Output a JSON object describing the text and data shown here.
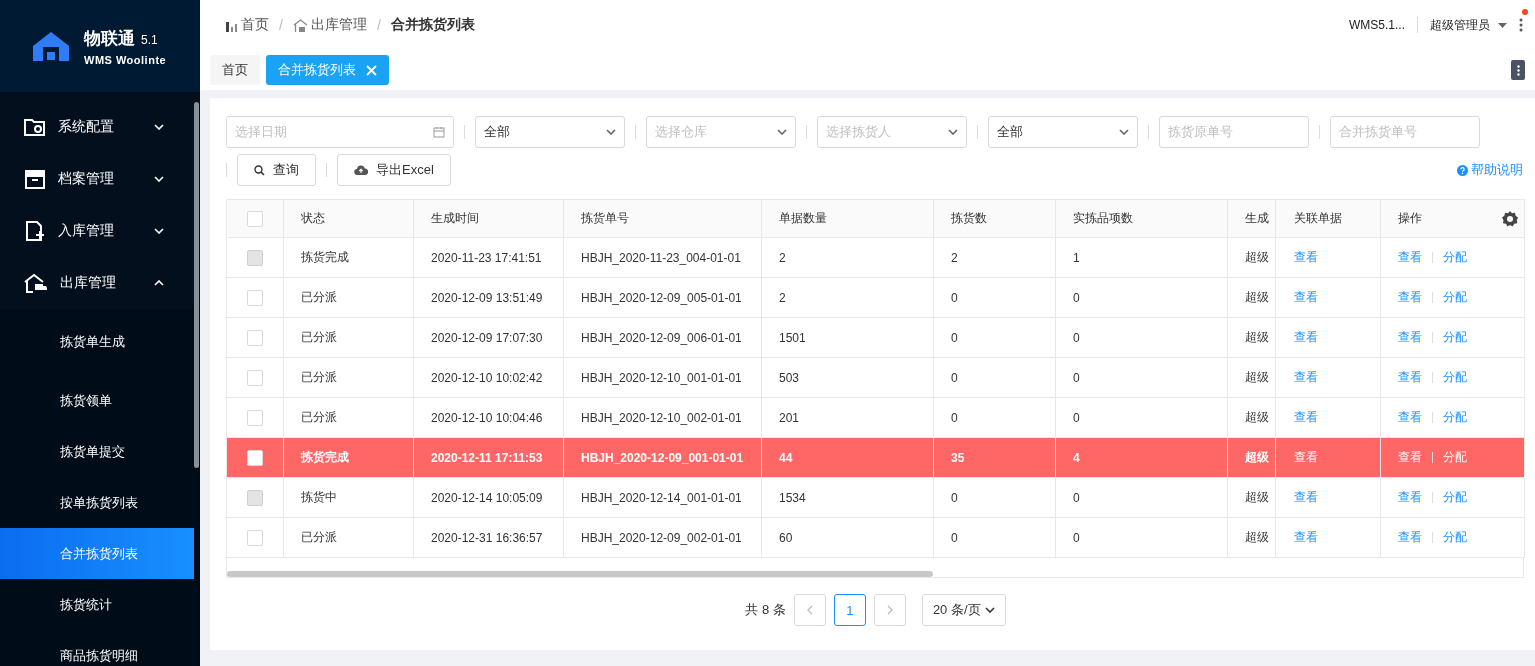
{
  "logo": {
    "name": "物联通",
    "version": "5.1",
    "subtitle": "WMS Woolinte"
  },
  "sidebar": {
    "items": [
      {
        "label": "系统配置",
        "expanded": false
      },
      {
        "label": "档案管理",
        "expanded": false
      },
      {
        "label": "入库管理",
        "expanded": false
      },
      {
        "label": "出库管理",
        "expanded": true,
        "children": [
          {
            "label": "拣货单生成",
            "selected": false
          },
          {
            "label": "拣货领单",
            "selected": false
          },
          {
            "label": "拣货单提交",
            "selected": false
          },
          {
            "label": "按单拣货列表",
            "selected": false
          },
          {
            "label": "合并拣货列表",
            "selected": true
          },
          {
            "label": "拣货统计",
            "selected": false
          },
          {
            "label": "商品拣货明细",
            "selected": false
          }
        ]
      }
    ]
  },
  "breadcrumb": [
    "首页",
    "出库管理",
    "合并拣货列表"
  ],
  "breadcrumb_separator": "/",
  "header": {
    "version": "WMS5.1...",
    "user": "超级管理员"
  },
  "tabs": [
    {
      "label": "首页",
      "selected": false,
      "closable": false
    },
    {
      "label": "合并拣货列表",
      "selected": true,
      "closable": true
    }
  ],
  "filters": [
    {
      "kind": "date",
      "placeholder": "选择日期"
    },
    {
      "kind": "select",
      "value": "全部"
    },
    {
      "kind": "select",
      "placeholder": "选择仓库"
    },
    {
      "kind": "select",
      "placeholder": "选择拣货人"
    },
    {
      "kind": "select",
      "value": "全部"
    },
    {
      "kind": "input",
      "placeholder": "拣货原单号"
    },
    {
      "kind": "input",
      "placeholder": "合并拣货单号"
    }
  ],
  "buttons": [
    {
      "kind": "search",
      "label": "查询"
    },
    {
      "kind": "export",
      "label": "导出Excel"
    }
  ],
  "help_link": "帮助说明",
  "table": {
    "select_all_checked": false,
    "columns": [
      "状态",
      "生成时间",
      "拣货单号",
      "单据数量",
      "拣货数",
      "实拣品项数",
      "生成",
      "关联单据",
      "操作"
    ],
    "rows": [
      {
        "selected": false,
        "checkbox_disabled": true,
        "cells": [
          "拣货完成",
          "2020-11-23 17:41:51",
          "HBJH_2020-11-23_004-01-01",
          "2",
          "2",
          "1",
          "超级"
        ],
        "related": "查看",
        "actions": [
          "查看",
          "分配"
        ]
      },
      {
        "selected": false,
        "checkbox_disabled": false,
        "cells": [
          "已分派",
          "2020-12-09 13:51:49",
          "HBJH_2020-12-09_005-01-01",
          "2",
          "0",
          "0",
          "超级"
        ],
        "related": "查看",
        "actions": [
          "查看",
          "分配"
        ]
      },
      {
        "selected": false,
        "checkbox_disabled": false,
        "cells": [
          "已分派",
          "2020-12-09 17:07:30",
          "HBJH_2020-12-09_006-01-01",
          "1501",
          "0",
          "0",
          "超级"
        ],
        "related": "查看",
        "actions": [
          "查看",
          "分配"
        ]
      },
      {
        "selected": false,
        "checkbox_disabled": false,
        "cells": [
          "已分派",
          "2020-12-10 10:02:42",
          "HBJH_2020-12-10_001-01-01",
          "503",
          "0",
          "0",
          "超级"
        ],
        "related": "查看",
        "actions": [
          "查看",
          "分配"
        ]
      },
      {
        "selected": false,
        "checkbox_disabled": false,
        "cells": [
          "已分派",
          "2020-12-10 10:04:46",
          "HBJH_2020-12-10_002-01-01",
          "201",
          "0",
          "0",
          "超级"
        ],
        "related": "查看",
        "actions": [
          "查看",
          "分配"
        ]
      },
      {
        "selected": true,
        "checkbox_disabled": false,
        "cells": [
          "拣货完成",
          "2020-12-11 17:11:53",
          "HBJH_2020-12-09_001-01-01",
          "44",
          "35",
          "4",
          "超级"
        ],
        "related": "查看",
        "actions": [
          "查看",
          "分配"
        ]
      },
      {
        "selected": false,
        "checkbox_disabled": true,
        "cells": [
          "拣货中",
          "2020-12-14 10:05:09",
          "HBJH_2020-12-14_001-01-01",
          "1534",
          "0",
          "0",
          "超级"
        ],
        "related": "查看",
        "actions": [
          "查看",
          "分配"
        ]
      },
      {
        "selected": false,
        "checkbox_disabled": false,
        "cells": [
          "已分派",
          "2020-12-31 16:36:57",
          "HBJH_2020-12-09_002-01-01",
          "60",
          "0",
          "0",
          "超级"
        ],
        "related": "查看",
        "actions": [
          "查看",
          "分配"
        ]
      }
    ]
  },
  "pagination": {
    "total": "共 8 条",
    "pages": [
      {
        "label": "1",
        "selected": true
      }
    ],
    "page_size": "20 条/页"
  }
}
